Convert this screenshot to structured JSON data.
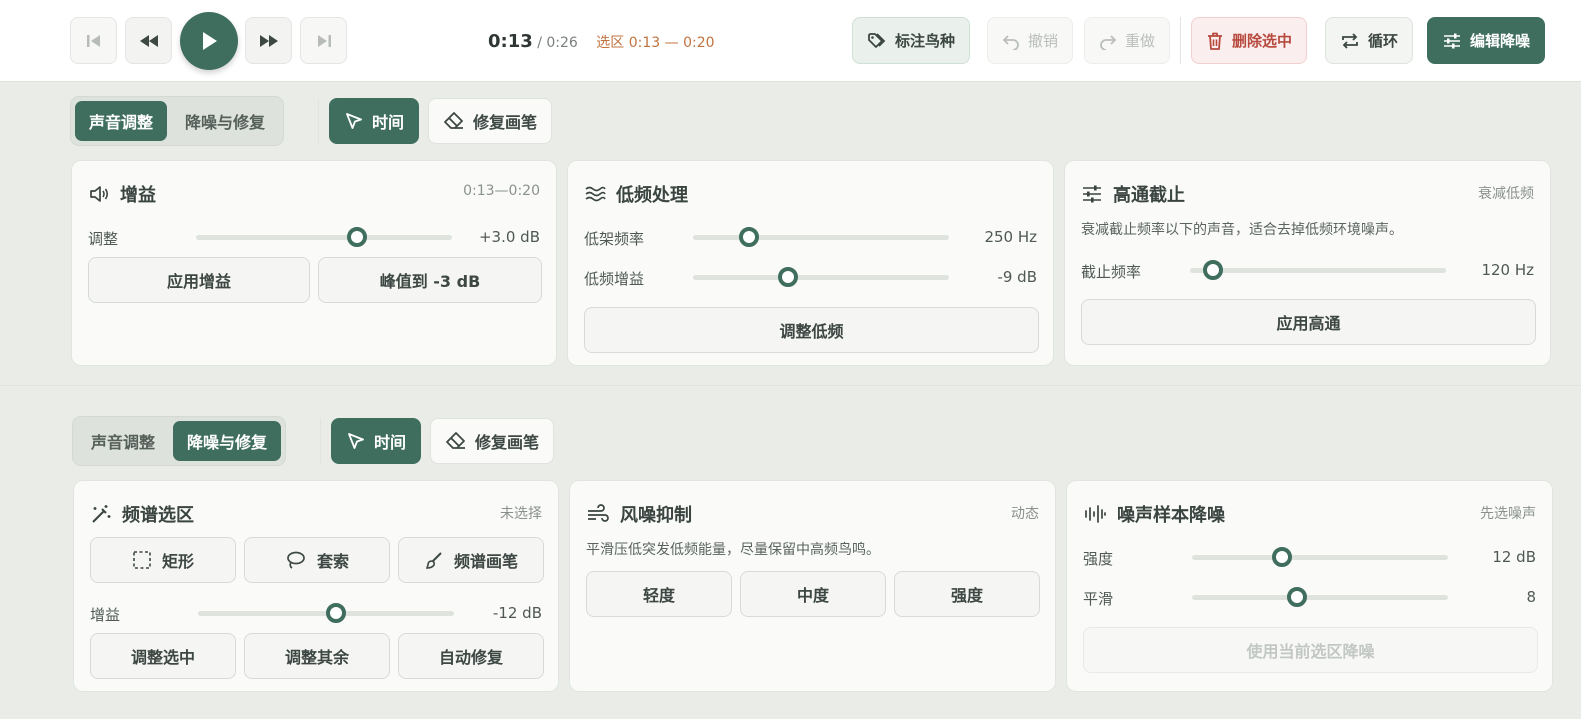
{
  "transport": {
    "current_time": "0:13",
    "total_time": "/ 0:26",
    "selection": "选区 0:13 — 0:20"
  },
  "toolbar": {
    "tag_species": "标注鸟种",
    "undo": "撤销",
    "redo": "重做",
    "delete_selected": "删除选中",
    "loop": "循环",
    "edit_denoise": "编辑降噪"
  },
  "section1": {
    "tabs": [
      "声音调整",
      "降噪与修复"
    ],
    "active_tab": 0,
    "tools": {
      "time": "时间",
      "repair_brush": "修复画笔"
    },
    "gain": {
      "title": "增益",
      "range": "0:13—0:20",
      "adjust_label": "调整",
      "adjust_value": "+3.0 dB",
      "adjust_level": 0.63,
      "apply_button": "应用增益",
      "peak_button": "峰值到 -3 dB"
    },
    "low_freq": {
      "title": "低频处理",
      "shelf_label": "低架频率",
      "shelf_value": "250 Hz",
      "shelf_level": 0.22,
      "gain_label": "低频增益",
      "gain_value": "-9 dB",
      "gain_level": 0.37,
      "button": "调整低频"
    },
    "highpass": {
      "title": "高通截止",
      "note": "衰减低频",
      "description": "衰减截止频率以下的声音，适合去掉低频环境噪声。",
      "cutoff_label": "截止频率",
      "cutoff_value": "120 Hz",
      "cutoff_level": 0.09,
      "button": "应用高通"
    }
  },
  "section2": {
    "tabs": [
      "声音调整",
      "降噪与修复"
    ],
    "active_tab": 1,
    "tools": {
      "time": "时间",
      "repair_brush": "修复画笔"
    },
    "spectral": {
      "title": "频谱选区",
      "status": "未选择",
      "rect": "矩形",
      "lasso": "套索",
      "brush": "频谱画笔",
      "gain_label": "增益",
      "gain_value": "-12 dB",
      "gain_level": 0.54,
      "adjust_selected": "调整选中",
      "adjust_rest": "调整其余",
      "auto_repair": "自动修复"
    },
    "wind": {
      "title": "风噪抑制",
      "status": "动态",
      "description": "平滑压低突发低频能量，尽量保留中高频鸟鸣。",
      "light": "轻度",
      "medium": "中度",
      "strong": "强度"
    },
    "noise_sample": {
      "title": "噪声样本降噪",
      "status": "先选噪声",
      "strength_label": "强度",
      "strength_value": "12 dB",
      "strength_level": 0.35,
      "smooth_label": "平滑",
      "smooth_value": "8",
      "smooth_level": 0.41,
      "button": "使用当前选区降噪"
    }
  }
}
